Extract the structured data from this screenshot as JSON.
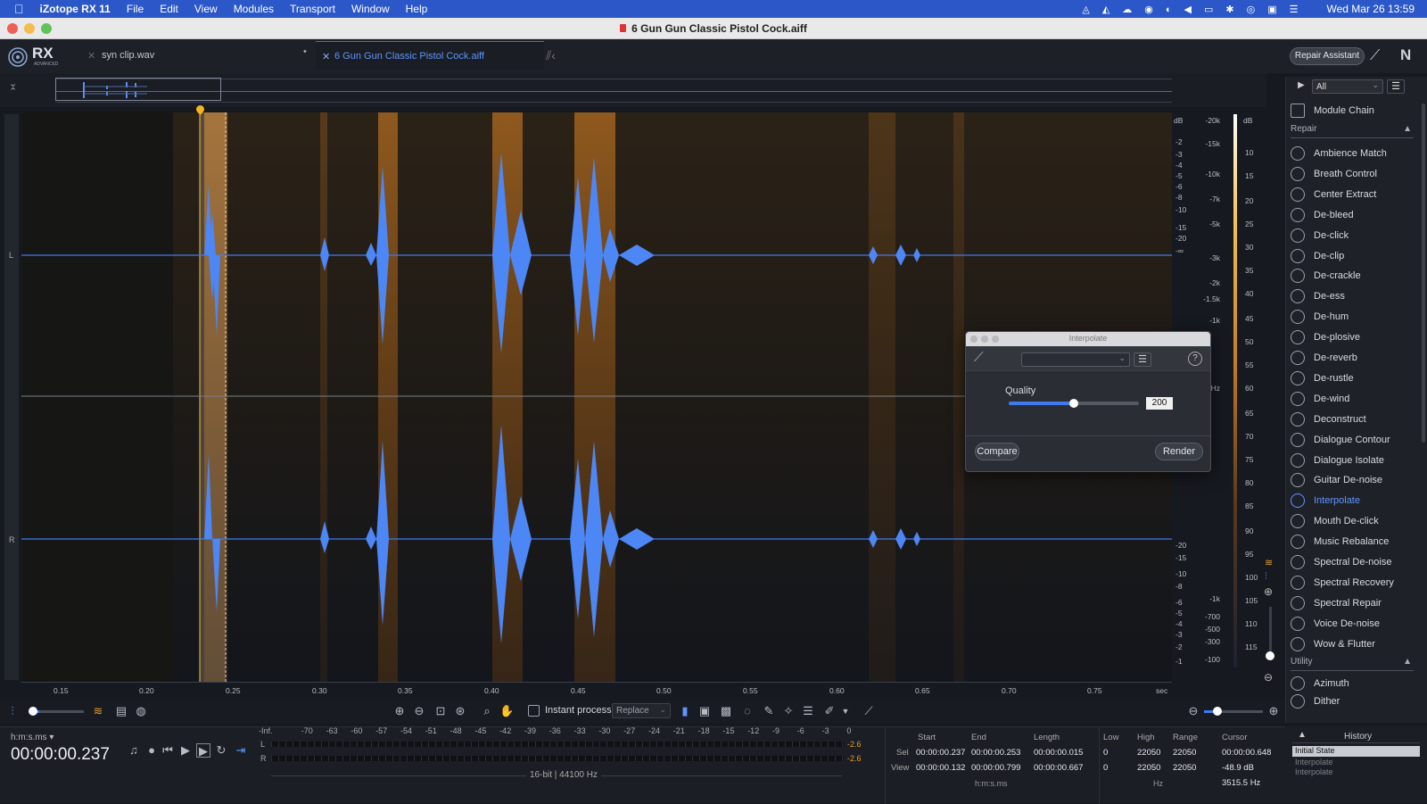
{
  "menubar": {
    "app": "iZotope RX 11",
    "items": [
      "File",
      "Edit",
      "View",
      "Modules",
      "Transport",
      "Window",
      "Help"
    ],
    "clock": "Wed Mar 26  13:59"
  },
  "window": {
    "title": "6 Gun Gun Classic Pistol Cock.aiff"
  },
  "tabs": [
    {
      "label": "syn clip.wav"
    },
    {
      "label": "6 Gun Gun Classic Pistol Cock.aiff"
    }
  ],
  "header": {
    "repair_assistant": "Repair Assistant",
    "logo": "RX",
    "logo_sub": "ADVANCED"
  },
  "channels": [
    "L",
    "R"
  ],
  "freq_scale": {
    "db_unit": "dB",
    "hz_unit": "Hz",
    "upper_db": [
      "-2",
      "-3",
      "-4",
      "-5",
      "-6",
      "-8",
      "-10",
      "-15",
      "-20",
      "-∞",
      "-20",
      "-15",
      "-10",
      "-8",
      "-6",
      "-5",
      "-4",
      "-3",
      "-2",
      "-1"
    ],
    "upper_hz": [
      "-20k",
      "-15k",
      "-10k",
      "-7k",
      "-5k",
      "-3k",
      "-2k",
      "-1.5k",
      "-1k",
      "-700",
      "-500",
      "-300",
      "-100"
    ]
  },
  "level_scale": {
    "unit": "dB",
    "values": [
      "10",
      "15",
      "20",
      "25",
      "30",
      "35",
      "40",
      "45",
      "50",
      "55",
      "60",
      "65",
      "70",
      "75",
      "80",
      "85",
      "90",
      "95",
      "100",
      "105",
      "110",
      "115"
    ]
  },
  "time_axis": {
    "unit": "sec",
    "ticks": [
      "0.15",
      "0.20",
      "0.25",
      "0.30",
      "0.35",
      "0.40",
      "0.45",
      "0.50",
      "0.55",
      "0.60",
      "0.65",
      "0.70",
      "0.75"
    ]
  },
  "sidebar": {
    "filter": "All",
    "module_chain": "Module Chain",
    "repair_header": "Repair",
    "items": [
      {
        "label": "Ambience Match"
      },
      {
        "label": "Breath Control"
      },
      {
        "label": "Center Extract"
      },
      {
        "label": "De-bleed"
      },
      {
        "label": "De-click"
      },
      {
        "label": "De-clip"
      },
      {
        "label": "De-crackle"
      },
      {
        "label": "De-ess"
      },
      {
        "label": "De-hum"
      },
      {
        "label": "De-plosive"
      },
      {
        "label": "De-reverb"
      },
      {
        "label": "De-rustle"
      },
      {
        "label": "De-wind"
      },
      {
        "label": "Deconstruct"
      },
      {
        "label": "Dialogue Contour"
      },
      {
        "label": "Dialogue Isolate"
      },
      {
        "label": "Guitar De-noise"
      },
      {
        "label": "Interpolate"
      },
      {
        "label": "Mouth De-click"
      },
      {
        "label": "Music Rebalance"
      },
      {
        "label": "Spectral De-noise"
      },
      {
        "label": "Spectral Recovery"
      },
      {
        "label": "Spectral Repair"
      },
      {
        "label": "Voice De-noise"
      },
      {
        "label": "Wow & Flutter"
      }
    ],
    "utility_header": "Utility",
    "utility_items": [
      {
        "label": "Azimuth"
      },
      {
        "label": "Dither"
      }
    ]
  },
  "dialog": {
    "title": "Interpolate",
    "quality_label": "Quality",
    "quality_value": "200",
    "quality_level": 0.5,
    "compare": "Compare",
    "render": "Render"
  },
  "toolbar": {
    "instant_process": "Instant process",
    "mode": "Replace"
  },
  "transport": {
    "format": "h:m:s.ms",
    "time": "00:00:00.237"
  },
  "meter": {
    "scale": [
      "-Inf.",
      "-70",
      "-63",
      "-60",
      "-57",
      "-54",
      "-51",
      "-48",
      "-45",
      "-42",
      "-39",
      "-36",
      "-33",
      "-30",
      "-27",
      "-24",
      "-21",
      "-18",
      "-15",
      "-12",
      "-9",
      "-6",
      "-3",
      "0"
    ],
    "peak_l": "-2.6",
    "peak_r": "-2.6",
    "format": "16-bit | 44100 Hz"
  },
  "selection": {
    "headers": [
      "Start",
      "End",
      "Length"
    ],
    "sel_label": "Sel",
    "view_label": "View",
    "sel": [
      "00:00:00.237",
      "00:00:00.253",
      "00:00:00.015"
    ],
    "view": [
      "00:00:00.132",
      "00:00:00.799",
      "00:00:00.667"
    ],
    "unit": "h:m:s.ms"
  },
  "freq_info": {
    "headers": [
      "Low",
      "High",
      "Range"
    ],
    "row1": [
      "0",
      "22050",
      "22050"
    ],
    "row2": [
      "0",
      "22050",
      "22050"
    ],
    "unit": "Hz"
  },
  "cursor": {
    "header": "Cursor",
    "time": "00:00:00.648",
    "db": "-48.9 dB",
    "hz": "3515.5 Hz"
  },
  "history": {
    "title": "History",
    "items": [
      "Initial State",
      "Interpolate",
      "Interpolate"
    ]
  }
}
